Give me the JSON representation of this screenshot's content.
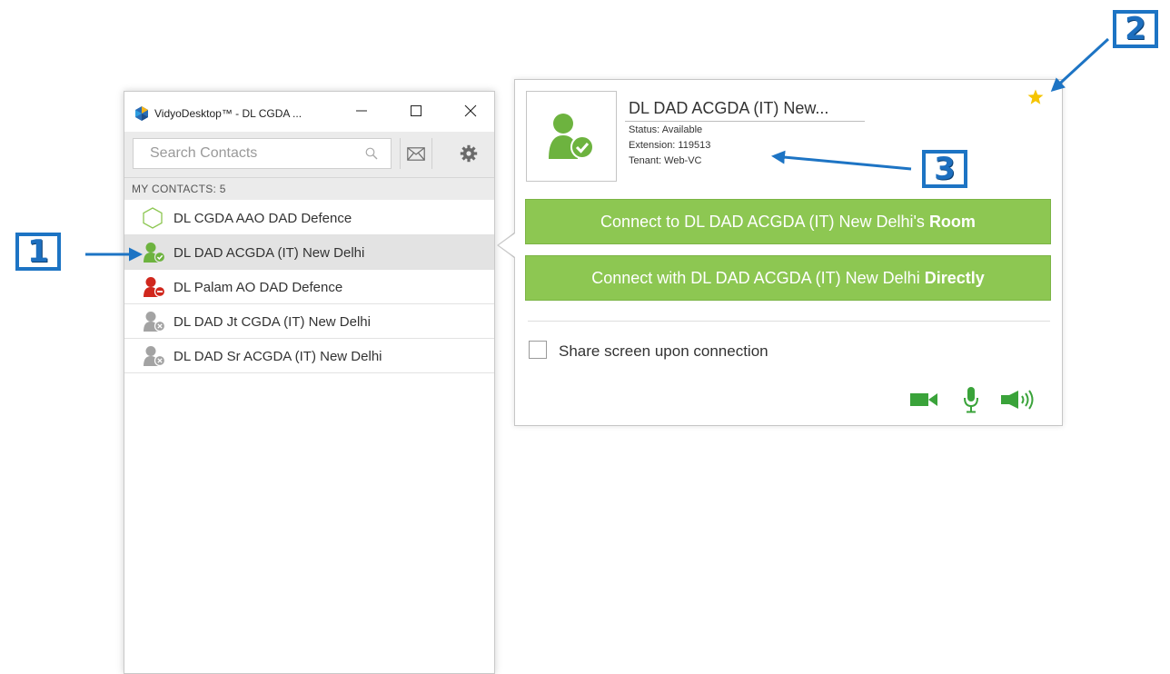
{
  "window": {
    "title": "VidyoDesktop™ - DL CGDA ...",
    "controls": {
      "minimize": "—",
      "maximize": "☐",
      "close": "✕"
    }
  },
  "search": {
    "placeholder": "Search Contacts",
    "value": ""
  },
  "contacts": {
    "header": "MY CONTACTS: 5",
    "items": [
      {
        "name": "DL CGDA AAO DAD Defence",
        "status": "room",
        "icon": "hexagon-outline-icon"
      },
      {
        "name": "DL DAD ACGDA (IT) New Delhi",
        "status": "available",
        "icon": "user-available-icon",
        "selected": true
      },
      {
        "name": "DL Palam AO DAD Defence",
        "status": "busy",
        "icon": "user-busy-icon"
      },
      {
        "name": "DL DAD Jt CGDA (IT) New Delhi",
        "status": "offline",
        "icon": "user-offline-icon"
      },
      {
        "name": "DL DAD Sr ACGDA (IT) New Delhi",
        "status": "offline",
        "icon": "user-offline-icon"
      }
    ]
  },
  "details": {
    "title": "DL DAD ACGDA (IT) New...",
    "status": "Status: Available",
    "extension": "Extension: 119513",
    "tenant": "Tenant: Web-VC",
    "connect_room_prefix": "Connect to DL DAD ACGDA (IT) New Delhi's",
    "connect_room_bold": "Room",
    "connect_direct_prefix": "Connect with DL DAD ACGDA (IT) New Delhi",
    "connect_direct_bold": "Directly",
    "share_label": "Share screen upon connection",
    "share_checked": false
  },
  "callouts": [
    "1",
    "2",
    "3"
  ],
  "colors": {
    "accent_green": "#8dc752",
    "status_available": "#6db33f",
    "status_busy": "#d0271d",
    "status_offline": "#9b9b9b",
    "star": "#f5c400",
    "callout_blue": "#1d74c4"
  }
}
